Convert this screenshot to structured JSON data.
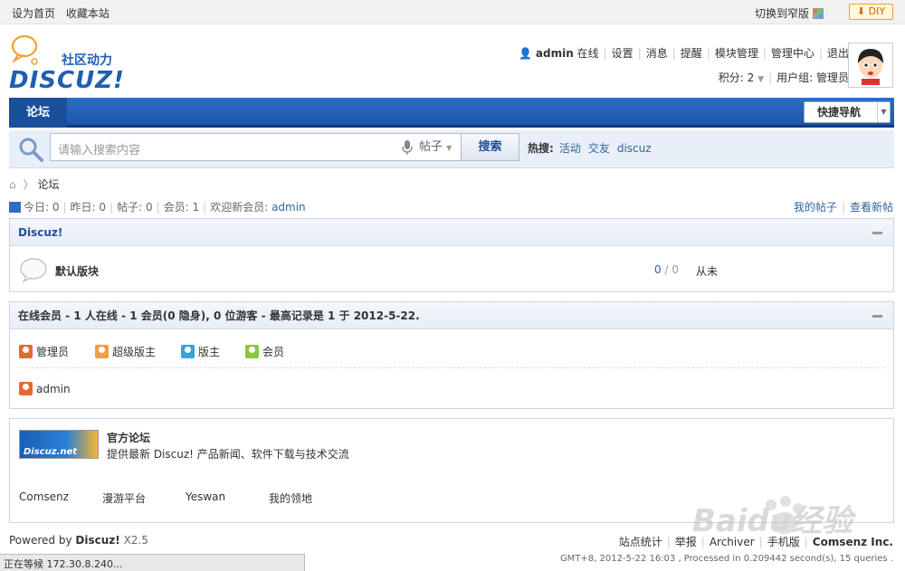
{
  "topbar": {
    "set_home": "设为首页",
    "bookmark": "收藏本站",
    "switch_narrow": "切换到窄版",
    "diy": "DIY"
  },
  "header": {
    "logo_tagline": "社区动力",
    "logo_text": "DISCUZ!",
    "username": "admin",
    "online": "在线",
    "menu": [
      "设置",
      "消息",
      "提醒",
      "模块管理",
      "管理中心",
      "退出"
    ],
    "credits_label": "积分:",
    "credits_value": "2",
    "usergroup_label": "用户组:",
    "usergroup_value": "管理员"
  },
  "nav": {
    "tab_forum": "论坛",
    "quick_nav": "快捷导航"
  },
  "search": {
    "placeholder": "请输入搜索内容",
    "type": "帖子",
    "button": "搜索",
    "hot_label": "热搜:",
    "hot": [
      "活动",
      "交友",
      "discuz"
    ]
  },
  "crumb": {
    "current": "论坛"
  },
  "stats": {
    "today": "今日: 0",
    "yesterday": "昨日: 0",
    "posts": "帖子: 0",
    "members": "会员: 1",
    "welcome": "欢迎新会员:",
    "newmember": "admin"
  },
  "mylinks": [
    "我的帖子",
    "查看新帖"
  ],
  "category": {
    "title": "Discuz!",
    "forum_name": "默认版块",
    "threads": "0",
    "posts": "0",
    "lastpost": "从未"
  },
  "online": {
    "title": "在线会员 - 1 人在线 - 1 会员(0 隐身), 0 位游客 - 最高记录是 1 于 2012-5-22.",
    "legend": [
      {
        "label": "管理员",
        "color": "#e8692f"
      },
      {
        "label": "超级版主",
        "color": "#f0a040"
      },
      {
        "label": "版主",
        "color": "#3aa3d8"
      },
      {
        "label": "会员",
        "color": "#8cc63e"
      }
    ],
    "user": "admin"
  },
  "links": {
    "logo_text": "Discuz.net",
    "title": "官方论坛",
    "desc": "提供最新 Discuz! 产品新闻、软件下载与技术交流",
    "items": [
      "Comsenz",
      "漫游平台",
      "Yeswan",
      "我的领地"
    ]
  },
  "footer": {
    "powered": "Powered by",
    "brand": "Discuz!",
    "version": "X2.5",
    "links": [
      "站点统计",
      "举报",
      "Archiver",
      "手机版"
    ],
    "company": "Comsenz Inc.",
    "gmt": "GMT+8, 2012-5-22 16:03 , Processed in 0.209442 second(s), 15 queries ."
  },
  "statusbar": "正在等候 172.30.8.240...",
  "watermark": "Baidu经验"
}
